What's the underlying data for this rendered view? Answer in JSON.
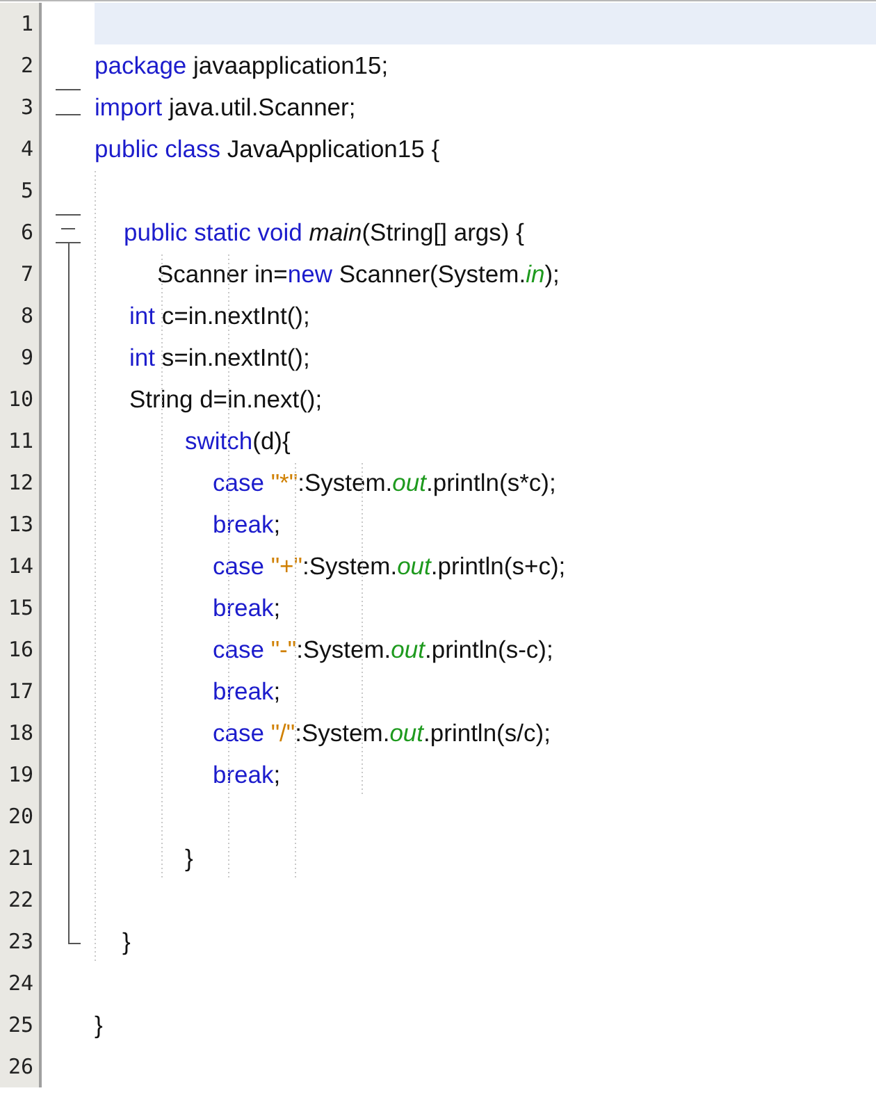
{
  "editor": {
    "lines": [
      {
        "number": "1",
        "current": true
      },
      {
        "number": "2",
        "current": false,
        "tokens": [
          {
            "kind": "keyword",
            "text": "package"
          },
          {
            "kind": "plain",
            "text": " javaapplication15;"
          }
        ]
      },
      {
        "number": "3",
        "current": false,
        "tokens": [
          {
            "kind": "keyword",
            "text": "import"
          },
          {
            "kind": "plain",
            "text": " java.util.Scanner;"
          }
        ]
      },
      {
        "number": "4",
        "current": false,
        "tokens": [
          {
            "kind": "keyword",
            "text": "public class"
          },
          {
            "kind": "plain",
            "text": " JavaApplication15 {"
          }
        ]
      },
      {
        "number": "5",
        "current": false
      },
      {
        "number": "6",
        "current": false,
        "tokens": [
          {
            "kind": "keyword",
            "text": "public static void "
          },
          {
            "kind": "method",
            "text": "main"
          },
          {
            "kind": "plain",
            "text": "(String[] args) {"
          }
        ]
      },
      {
        "number": "7",
        "current": false,
        "tokens": [
          {
            "kind": "plain",
            "text": "Scanner in="
          },
          {
            "kind": "keyword",
            "text": "new"
          },
          {
            "kind": "plain",
            "text": " Scanner(System."
          },
          {
            "kind": "field",
            "text": "in"
          },
          {
            "kind": "plain",
            "text": ");"
          }
        ]
      },
      {
        "number": "8",
        "current": false,
        "tokens": [
          {
            "kind": "keyword",
            "text": "int"
          },
          {
            "kind": "plain",
            "text": " c=in.nextInt();"
          }
        ]
      },
      {
        "number": "9",
        "current": false,
        "tokens": [
          {
            "kind": "keyword",
            "text": "int"
          },
          {
            "kind": "plain",
            "text": " s=in.nextInt();"
          }
        ]
      },
      {
        "number": "10",
        "current": false,
        "tokens": [
          {
            "kind": "plain",
            "text": "String d=in.next();"
          }
        ]
      },
      {
        "number": "11",
        "current": false,
        "tokens": [
          {
            "kind": "keyword",
            "text": "switch"
          },
          {
            "kind": "plain",
            "text": "(d){"
          }
        ]
      },
      {
        "number": "12",
        "current": false,
        "tokens": [
          {
            "kind": "keyword",
            "text": "case "
          },
          {
            "kind": "string",
            "text": "\"*\""
          },
          {
            "kind": "plain",
            "text": ":System."
          },
          {
            "kind": "field",
            "text": "out"
          },
          {
            "kind": "plain",
            "text": ".println(s*c);"
          }
        ]
      },
      {
        "number": "13",
        "current": false,
        "tokens": [
          {
            "kind": "keyword",
            "text": "break"
          },
          {
            "kind": "plain",
            "text": ";"
          }
        ]
      },
      {
        "number": "14",
        "current": false,
        "tokens": [
          {
            "kind": "keyword",
            "text": "case "
          },
          {
            "kind": "string",
            "text": "\"+\""
          },
          {
            "kind": "plain",
            "text": ":System."
          },
          {
            "kind": "field",
            "text": "out"
          },
          {
            "kind": "plain",
            "text": ".println(s+c);"
          }
        ]
      },
      {
        "number": "15",
        "current": false,
        "tokens": [
          {
            "kind": "keyword",
            "text": "break"
          },
          {
            "kind": "plain",
            "text": ";"
          }
        ]
      },
      {
        "number": "16",
        "current": false,
        "tokens": [
          {
            "kind": "keyword",
            "text": "case "
          },
          {
            "kind": "string",
            "text": "\"-\""
          },
          {
            "kind": "plain",
            "text": ":System."
          },
          {
            "kind": "field",
            "text": "out"
          },
          {
            "kind": "plain",
            "text": ".println(s-c);"
          }
        ]
      },
      {
        "number": "17",
        "current": false,
        "tokens": [
          {
            "kind": "keyword",
            "text": "break"
          },
          {
            "kind": "plain",
            "text": ";"
          }
        ]
      },
      {
        "number": "18",
        "current": false,
        "tokens": [
          {
            "kind": "keyword",
            "text": "case "
          },
          {
            "kind": "string",
            "text": "\"/\""
          },
          {
            "kind": "plain",
            "text": ":System."
          },
          {
            "kind": "field",
            "text": "out"
          },
          {
            "kind": "plain",
            "text": ".println(s/c);"
          }
        ]
      },
      {
        "number": "19",
        "current": false,
        "tokens": [
          {
            "kind": "keyword",
            "text": "break"
          },
          {
            "kind": "plain",
            "text": ";"
          }
        ]
      },
      {
        "number": "20",
        "current": false
      },
      {
        "number": "21",
        "current": false,
        "tokens": [
          {
            "kind": "plain",
            "text": "}"
          }
        ]
      },
      {
        "number": "22",
        "current": false
      },
      {
        "number": "23",
        "current": false,
        "tokens": [
          {
            "kind": "plain",
            "text": "}"
          }
        ]
      },
      {
        "number": "24",
        "current": false
      },
      {
        "number": "25",
        "current": false,
        "tokens": [
          {
            "kind": "plain",
            "text": "}"
          }
        ]
      },
      {
        "number": "26",
        "current": false
      }
    ]
  }
}
